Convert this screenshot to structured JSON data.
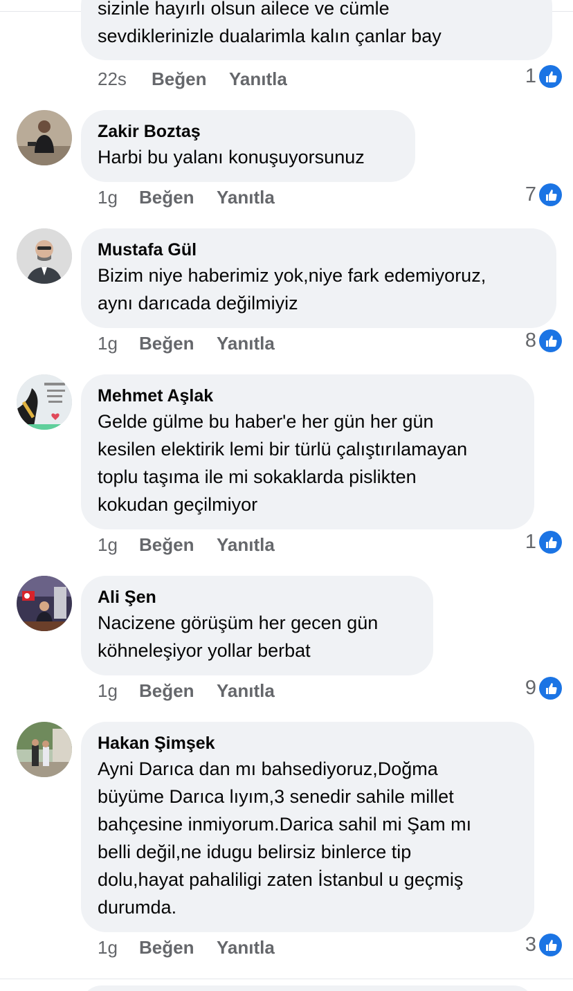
{
  "first_comment": {
    "text_line1": "sizinle hayırlı olsun ailece ve cümle",
    "text_line2": "sevdiklerinizle dualarimla kalın çanlar bay",
    "time": "22s",
    "like": "Beğen",
    "reply": "Yanıtla",
    "reactions": "1"
  },
  "comments": [
    {
      "author": "Zakir Boztaş",
      "lines": [
        "Harbi bu yalanı konuşuyorsunuz"
      ],
      "time": "1g",
      "like": "Beğen",
      "reply": "Yanıtla",
      "reactions": "7"
    },
    {
      "author": "Mustafa Gül",
      "lines": [
        "Bizim niye haberimiz yok,niye fark edemiyoruz,",
        "aynı darıcada değilmiyiz"
      ],
      "time": "1g",
      "like": "Beğen",
      "reply": "Yanıtla",
      "reactions": "8"
    },
    {
      "author": "Mehmet Aşlak",
      "lines": [
        "Gelde gülme bu haber'e her gün her gün",
        "kesilen elektirik lemi bir türlü çalıştırılamayan",
        "toplu taşıma ile mi sokaklarda pislikten",
        "kokudan geçilmiyor"
      ],
      "time": "1g",
      "like": "Beğen",
      "reply": "Yanıtla",
      "reactions": "1"
    },
    {
      "author": "Ali Şen",
      "lines": [
        "Nacizene görüşüm her gecen gün",
        "köhneleşiyor yollar berbat"
      ],
      "time": "1g",
      "like": "Beğen",
      "reply": "Yanıtla",
      "reactions": "9"
    },
    {
      "author": "Hakan Şimşek",
      "lines": [
        "Ayni Darıca dan mı bahsediyoruz,Doğma",
        "büyüme Darıca lıyım,3 senedir sahile millet",
        "bahçesine inmiyorum.Darica sahil mi Şam mı",
        "belli değil,ne idugu belirsiz binlerce tip",
        "dolu,hayat pahaliligi zaten İstanbul u geçmiş",
        "durumda."
      ],
      "time": "1g",
      "like": "Beğen",
      "reply": "Yanıtla",
      "reactions": "3"
    }
  ],
  "colors": {
    "bubble": "#f0f2f5",
    "meta": "#65676b",
    "like_blue": "#1b74e4"
  },
  "icons": {
    "reaction": "like-thumb-icon"
  }
}
